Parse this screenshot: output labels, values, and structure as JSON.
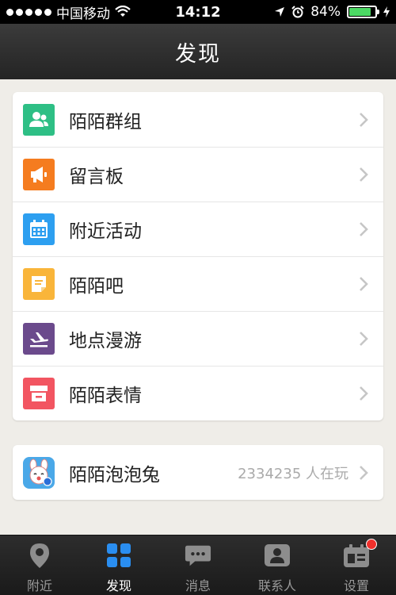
{
  "status_bar": {
    "carrier": "中国移动",
    "time": "14:12",
    "battery": "84%",
    "battery_level": 0.84
  },
  "header": {
    "title": "发现"
  },
  "menu": {
    "items": [
      {
        "label": "陌陌群组",
        "icon": "group-icon",
        "color": "#2ebf85"
      },
      {
        "label": "留言板",
        "icon": "megaphone-icon",
        "color": "#f57c1f"
      },
      {
        "label": "附近活动",
        "icon": "calendar-icon",
        "color": "#2d9ff0"
      },
      {
        "label": "陌陌吧",
        "icon": "note-icon",
        "color": "#f9b53a"
      },
      {
        "label": "地点漫游",
        "icon": "plane-icon",
        "color": "#6b4a8c"
      },
      {
        "label": "陌陌表情",
        "icon": "store-icon",
        "color": "#f25561"
      }
    ]
  },
  "game": {
    "label": "陌陌泡泡兔",
    "players": "2334235 人在玩",
    "icon": "bubble-rabbit-icon"
  },
  "tabbar": {
    "tabs": [
      {
        "label": "附近",
        "icon": "location-pin-icon"
      },
      {
        "label": "发现",
        "icon": "discover-grid-icon"
      },
      {
        "label": "消息",
        "icon": "message-bubble-icon"
      },
      {
        "label": "联系人",
        "icon": "contact-icon"
      },
      {
        "label": "设置",
        "icon": "settings-icon"
      }
    ]
  }
}
